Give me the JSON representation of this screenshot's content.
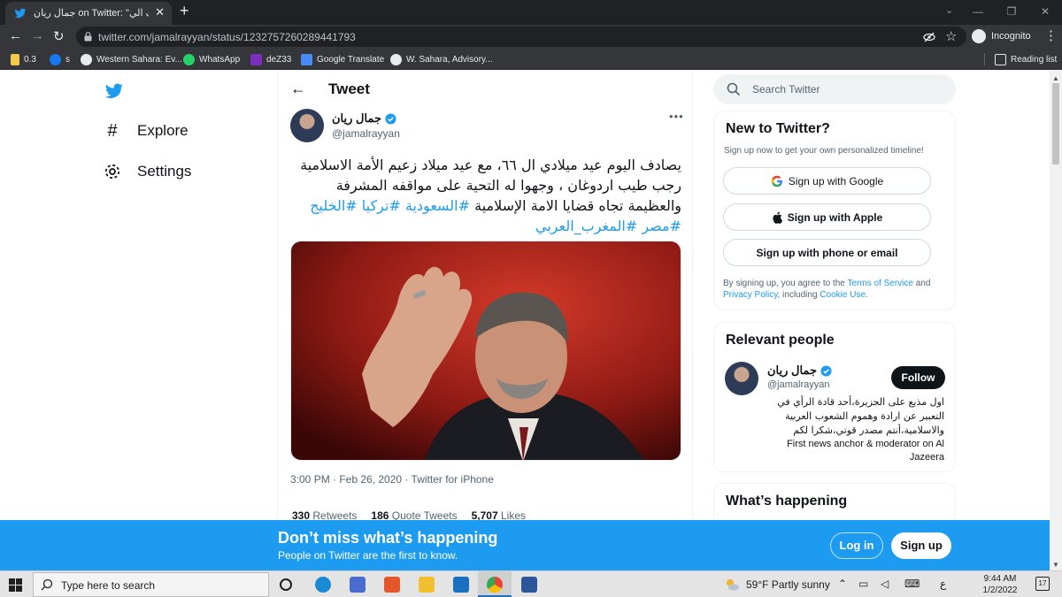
{
  "browser": {
    "tab_title": "جمال ريان on Twitter: \"يصادف الي",
    "url": "twitter.com/jamalrayyan/status/1232757260289441793",
    "incognito_label": "Incognito",
    "bookmarks": [
      "0.3",
      "s",
      "Western Sahara: Ev...",
      "WhatsApp",
      "deZ33",
      "Google Translate",
      "W. Sahara, Advisory..."
    ],
    "reading_list": "Reading list"
  },
  "sidebar": {
    "explore": "Explore",
    "settings": "Settings"
  },
  "tweet": {
    "header": "Tweet",
    "author_name": "جمال ريان",
    "author_handle": "@jamalrayyan",
    "text": "يصادف اليوم عيد ميلادي ال ٦٦، مع عيد ميلاد زعيم الأمة الاسلامية رجب طيب اردوغان ، وجهوا له التحية على مواقفه المشرفة والعظيمة تجاه قضايا الامة الإسلامية",
    "hashtags": "#السعودية #تركيا #الخليج #مصر #المغرب_العربي",
    "meta": "3:00 PM · Feb 26, 2020 · Twitter for iPhone",
    "retweets_count": "330",
    "retweets_label": "Retweets",
    "quotes_count": "186",
    "quotes_label": "Quote Tweets",
    "likes_count": "5,707",
    "likes_label": "Likes"
  },
  "right": {
    "search_placeholder": "Search Twitter",
    "new_title": "New to Twitter?",
    "new_sub": "Sign up now to get your own personalized timeline!",
    "signup_google": "Sign up with Google",
    "signup_apple": "Sign up with Apple",
    "signup_phone": "Sign up with phone or email",
    "terms_1": "By signing up, you agree to the ",
    "terms_tos": "Terms of Service",
    "terms_2": " and ",
    "terms_pp": "Privacy Policy",
    "terms_3": ", including ",
    "terms_cookie": "Cookie Use",
    "terms_4": ".",
    "relevant_title": "Relevant people",
    "rp_name": "جمال ريان",
    "rp_handle": "@jamalrayyan",
    "follow": "Follow",
    "rp_bio_ar": "اول مذيع على الجزيرة،أحد قادة الرأي في التعبير عن ارادة وهموم الشعوب العربية والاسلامية،أنتم مصدر قوتي،شكرا لكم",
    "rp_bio_en": "First news anchor & moderator on Al Jazeera",
    "happening_title": "What’s happening"
  },
  "banner": {
    "title": "Don’t miss what’s happening",
    "subtitle": "People on Twitter are the first to know.",
    "login": "Log in",
    "signup": "Sign up"
  },
  "taskbar": {
    "search_text": "Type here to search",
    "weather": "59°F  Partly sunny",
    "lang": "ع",
    "time": "9:44 AM",
    "date": "1/2/2022",
    "notifications": "17"
  },
  "colors": {
    "twitter_blue": "#1d9bf0",
    "chrome_dark": "#35363a"
  }
}
